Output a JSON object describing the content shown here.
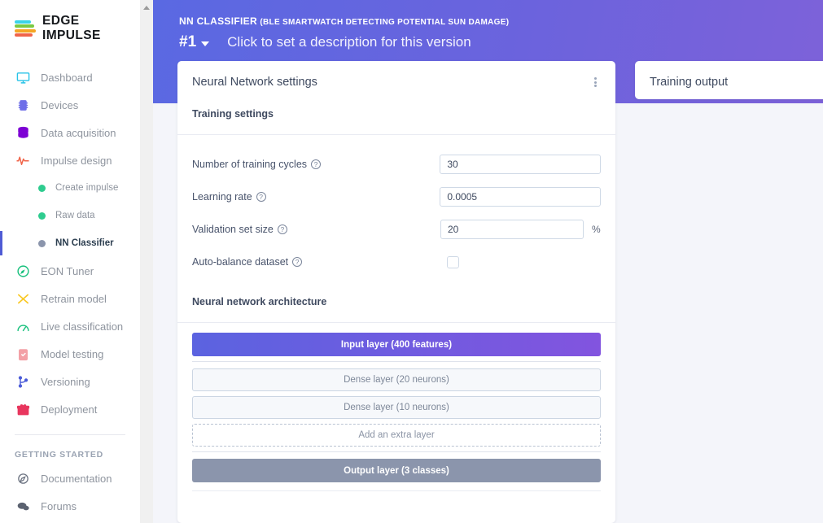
{
  "brand": {
    "name": "EDGE IMPULSE"
  },
  "sidebar": {
    "items": [
      {
        "label": "Dashboard",
        "icon": "monitor-icon"
      },
      {
        "label": "Devices",
        "icon": "chip-icon"
      },
      {
        "label": "Data acquisition",
        "icon": "database-icon"
      },
      {
        "label": "Impulse design",
        "icon": "pulse-icon"
      }
    ],
    "sub_items": [
      {
        "label": "Create impulse",
        "icon": "dot-icon",
        "dot_color": "#2ecc8f",
        "active": false
      },
      {
        "label": "Raw data",
        "icon": "dot-icon",
        "dot_color": "#2ecc8f",
        "active": false
      },
      {
        "label": "NN Classifier",
        "icon": "dot-icon",
        "dot_color": "#8b95ac",
        "active": true
      }
    ],
    "items2": [
      {
        "label": "EON Tuner",
        "icon": "compass-icon"
      },
      {
        "label": "Retrain model",
        "icon": "shuffle-icon"
      },
      {
        "label": "Live classification",
        "icon": "gauge-icon"
      },
      {
        "label": "Model testing",
        "icon": "clipboard-check-icon"
      },
      {
        "label": "Versioning",
        "icon": "branch-icon"
      },
      {
        "label": "Deployment",
        "icon": "gift-icon"
      }
    ],
    "section_label": "GETTING STARTED",
    "items3": [
      {
        "label": "Documentation",
        "icon": "compass-doc-icon"
      },
      {
        "label": "Forums",
        "icon": "chat-icon"
      }
    ]
  },
  "header": {
    "kicker_bold": "NN CLASSIFIER",
    "kicker_paren": "(BLE SMARTWATCH DETECTING POTENTIAL SUN DAMAGE)",
    "version": "#1",
    "description": "Click to set a description for this version",
    "gradient_from": "#5a69e2",
    "gradient_to": "#7d62d9"
  },
  "nn_card": {
    "title": "Neural Network settings",
    "menu_icon": "kebab-menu-icon",
    "training_settings_label": "Training settings",
    "fields": [
      {
        "label": "Number of training cycles",
        "value": "30",
        "help": "?",
        "suffix": ""
      },
      {
        "label": "Learning rate",
        "value": "0.0005",
        "help": "?",
        "suffix": ""
      },
      {
        "label": "Validation set size",
        "value": "20",
        "help": "?",
        "suffix": "%"
      }
    ],
    "checkbox_field": {
      "label": "Auto-balance dataset",
      "help": "?",
      "checked": false
    },
    "architecture_label": "Neural network architecture",
    "layers": {
      "input": "Input layer (400 features)",
      "dense": [
        "Dense layer (20 neurons)",
        "Dense layer (10 neurons)"
      ],
      "add": "Add an extra layer",
      "output": "Output layer (3 classes)"
    }
  },
  "output_card": {
    "title": "Training output"
  }
}
